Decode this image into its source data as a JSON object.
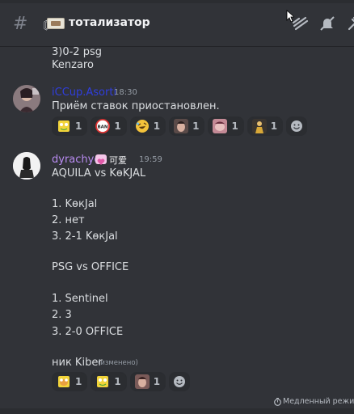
{
  "header": {
    "channel_prefix": "〘",
    "channel_name": "тотализатор"
  },
  "top_message": {
    "lines": [
      "3)0-2 psg",
      "Kenzaro"
    ]
  },
  "message1": {
    "username": "iCCup.Asorti",
    "timestamp": "18:30",
    "text": "Приём ставок приостановлен.",
    "reactions": [
      {
        "emoji": "sponge-emoji",
        "count": "1"
      },
      {
        "emoji": "ban-emoji",
        "count": "1"
      },
      {
        "emoji": "rofl-emoji",
        "count": "1"
      },
      {
        "emoji": "face-emoji",
        "count": "1"
      },
      {
        "emoji": "blush-emoji",
        "count": "1"
      },
      {
        "emoji": "figure-emoji",
        "count": "1"
      }
    ]
  },
  "message2": {
    "username": "dyrachyo",
    "tag": "可爱",
    "timestamp": "19:59",
    "lines": [
      "AQUILA vs KөKJAL",
      "",
      "1. KөкJal",
      "2. нет",
      "3. 2-1 KөкJal",
      "",
      "PSG vs OFFICE",
      "",
      "1. Sentinel",
      "2. 3",
      "3. 2-0 OFFICE",
      "",
      "ник  Kiber"
    ],
    "edited_label": "(изменено)",
    "reactions": [
      {
        "emoji": "sponge-hide-emoji",
        "count": "1"
      },
      {
        "emoji": "sponge-emoji",
        "count": "1"
      },
      {
        "emoji": "face-emoji",
        "count": "1"
      }
    ]
  },
  "footer": {
    "slowmode_text": "Медленный режим в"
  },
  "colors": {
    "background": "#313338",
    "username1": "#2f3ede",
    "username2": "#b98cf2",
    "text": "#dbdee1"
  }
}
